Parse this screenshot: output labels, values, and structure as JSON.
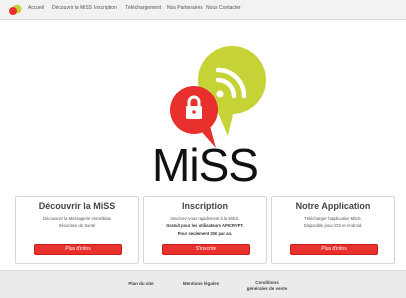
{
  "nav": {
    "items": [
      "Accueil",
      "Découvrir la MiSS",
      "Inscription",
      "Téléchargement",
      "Nos Partenaires",
      "Nous Contacter"
    ]
  },
  "brand": {
    "wordmark": "MiSS",
    "colors": {
      "red": "#e8302d",
      "green": "#c6d337",
      "text": "#111111"
    }
  },
  "cards": [
    {
      "title": "Découvrir la MiSS",
      "lines": [
        "Découvrez la Messagerie Immédiate",
        "Sécurisée de Santé"
      ],
      "button": "Plus d'infos"
    },
    {
      "title": "Inscription",
      "lines": [
        "Inscrivez-vous rapidement à la MiSS.",
        "Gratuit pour les utilisateurs APICRYPT.",
        "Pour seulement 20€ par an."
      ],
      "button": "S'inscrire"
    },
    {
      "title": "Notre Application",
      "lines": [
        "Télécharger l'application MiSS.",
        "Disponible pour iOS et Android."
      ],
      "button": "Plus d'infos"
    }
  ],
  "footer": {
    "links": [
      "Plan du site",
      "Mentions légales",
      "Conditions générales de vente"
    ]
  }
}
